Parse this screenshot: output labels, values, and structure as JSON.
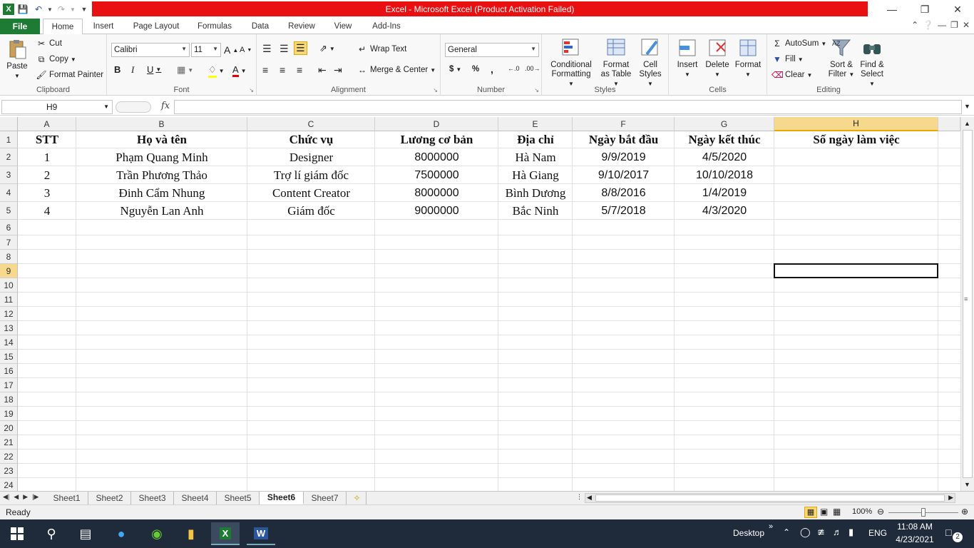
{
  "window": {
    "title": "Excel - Microsoft Excel (Product Activation Failed)",
    "title_bar_color": "#e81010"
  },
  "ribbon_tabs": [
    "File",
    "Home",
    "Insert",
    "Page Layout",
    "Formulas",
    "Data",
    "Review",
    "View",
    "Add-Ins"
  ],
  "ribbon": {
    "clipboard": {
      "label": "Clipboard",
      "paste": "Paste",
      "cut": "Cut",
      "copy": "Copy",
      "format_painter": "Format Painter"
    },
    "font": {
      "label": "Font",
      "family": "Calibri",
      "size": "11"
    },
    "alignment": {
      "label": "Alignment",
      "wrap_text": "Wrap Text",
      "merge_center": "Merge & Center"
    },
    "number": {
      "label": "Number",
      "format": "General",
      "currency": "$",
      "percent": "%",
      "comma": ","
    },
    "styles": {
      "label": "Styles",
      "conditional_1": "Conditional",
      "conditional_2": "Formatting",
      "format_table_1": "Format",
      "format_table_2": "as Table",
      "cell_styles_1": "Cell",
      "cell_styles_2": "Styles"
    },
    "cells": {
      "label": "Cells",
      "insert": "Insert",
      "delete": "Delete",
      "format": "Format"
    },
    "editing": {
      "label": "Editing",
      "autosum": "AutoSum",
      "fill": "Fill",
      "clear": "Clear",
      "sort_1": "Sort &",
      "sort_2": "Filter",
      "find_1": "Find &",
      "find_2": "Select"
    }
  },
  "formula_bar": {
    "name_box": "H9",
    "fx": "fx",
    "value": ""
  },
  "columns": [
    "A",
    "B",
    "C",
    "D",
    "E",
    "F",
    "G",
    "H"
  ],
  "rows": [
    "1",
    "2",
    "3",
    "4",
    "5",
    "6",
    "7",
    "8",
    "9",
    "10",
    "11",
    "12",
    "13",
    "14",
    "15",
    "16",
    "17",
    "18",
    "19",
    "20",
    "21",
    "22",
    "23",
    "24"
  ],
  "table": {
    "headers": [
      "STT",
      "Họ và tên",
      "Chức vụ",
      "Lương cơ bản",
      "Địa chỉ",
      "Ngày bắt đầu",
      "Ngày kết thúc",
      "Số ngày làm việc"
    ],
    "rows": [
      [
        "1",
        "Phạm Quang Minh",
        "Designer",
        "8000000",
        "Hà Nam",
        "9/9/2019",
        "4/5/2020",
        ""
      ],
      [
        "2",
        "Trần Phương Thảo",
        "Trợ lí giám đốc",
        "7500000",
        "Hà Giang",
        "9/10/2017",
        "10/10/2018",
        ""
      ],
      [
        "3",
        "Đinh Cẩm Nhung",
        "Content Creator",
        "8000000",
        "Bình Dương",
        "8/8/2016",
        "1/4/2019",
        ""
      ],
      [
        "4",
        "Nguyễn Lan Anh",
        "Giám đốc",
        "9000000",
        "Bắc Ninh",
        "5/7/2018",
        "4/3/2020",
        ""
      ]
    ]
  },
  "selected_cell": "H9",
  "sheets": [
    "Sheet1",
    "Sheet2",
    "Sheet3",
    "Sheet4",
    "Sheet5",
    "Sheet6",
    "Sheet7"
  ],
  "active_sheet": "Sheet6",
  "status": {
    "ready": "Ready",
    "zoom": "100%"
  },
  "taskbar": {
    "desktop": "Desktop",
    "lang": "ENG",
    "time": "11:08 AM",
    "date": "4/23/2021",
    "notifications": "2"
  }
}
